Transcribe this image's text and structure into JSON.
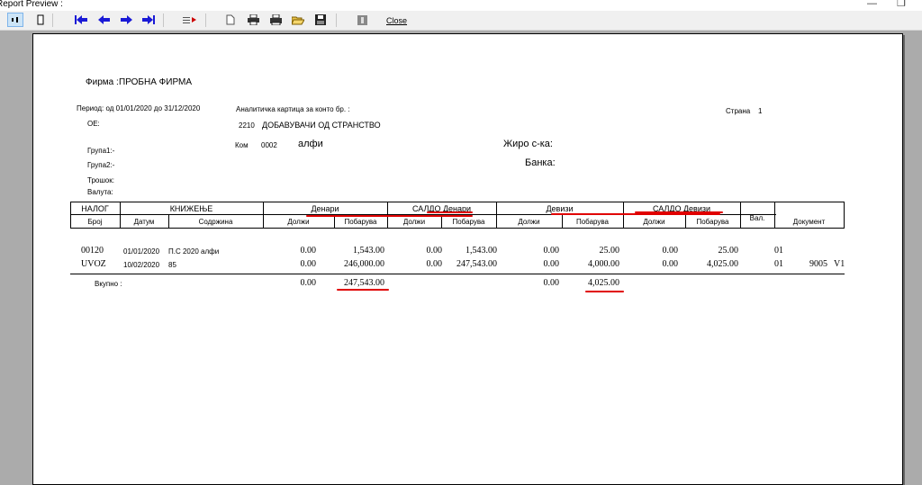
{
  "window": {
    "title": "Report Preview :"
  },
  "toolbar": {
    "close_label": "Close"
  },
  "report": {
    "firma_label": "Фирма :",
    "firma_value": "ПРОБНА ФИРМА",
    "period": "Период: од 01/01/2020 до 31/12/2020",
    "oe_label": "ОЕ:",
    "card_title": "Аналитичка картица за конто бр. :",
    "konto_num": "2210",
    "konto_name": "ДОБАВУВАЧИ ОД СТРАНСТВО",
    "page_label": "Страна",
    "page_num": "1",
    "kom_label": "Ком",
    "kom_code": "0002",
    "kom_name": "алфи",
    "giro_label": "Жиро с-ка:",
    "bank_label": "Банка:",
    "grupa1": "Група1:-",
    "grupa2": "Група2:-",
    "trosok": "Трошок:",
    "valuta": "Валута:"
  },
  "table": {
    "h_nalog": "НАЛОГ",
    "h_knizenje": "КНИЖЕЊЕ",
    "h_denari": "Денари",
    "h_saldo_denari": "САЛДО Денари",
    "h_devizi": "Девизи",
    "h_saldo_devizi": "САЛДО Девизи",
    "h_val": "Вал.",
    "h_dokument": "Документ",
    "sub": {
      "broj": "Број",
      "datum": "Датум",
      "sodrzina": "Содржина",
      "dolzi1": "Должи",
      "pobaruva1": "Побарува",
      "dolzi2": "Должи",
      "pobaruva2": "Побарува",
      "dolzi3": "Должи",
      "pobaruva3": "Побарува",
      "dolzi4": "Должи",
      "pobaruva4": "Побарува"
    },
    "rows": [
      {
        "broj": "00120",
        "datum": "01/01/2020",
        "sodrzina": "П.С 2020 алфи",
        "den_dolzi": "0.00",
        "den_pobaruva": "1,543.00",
        "sd_dolzi": "0.00",
        "sd_pobaruva": "1,543.00",
        "dev_dolzi": "0.00",
        "dev_pobaruva": "25.00",
        "sdv_dolzi": "0.00",
        "sdv_pobaruva": "25.00",
        "val": "01",
        "dok_num": "",
        "dok_code": ""
      },
      {
        "broj": "UVOZ",
        "datum": "10/02/2020",
        "sodrzina": "85",
        "den_dolzi": "0.00",
        "den_pobaruva": "246,000.00",
        "sd_dolzi": "0.00",
        "sd_pobaruva": "247,543.00",
        "dev_dolzi": "0.00",
        "dev_pobaruva": "4,000.00",
        "sdv_dolzi": "0.00",
        "sdv_pobaruva": "4,025.00",
        "val": "01",
        "dok_num": "9005",
        "dok_code": "V1"
      }
    ],
    "total": {
      "label": "Вкупно :",
      "den_dolzi": "0.00",
      "den_pobaruva": "247,543.00",
      "dev_dolzi": "0.00",
      "dev_pobaruva": "4,025.00"
    }
  },
  "colors": {
    "highlight": "#e00000",
    "nav_arrow": "#1a1ad6"
  }
}
